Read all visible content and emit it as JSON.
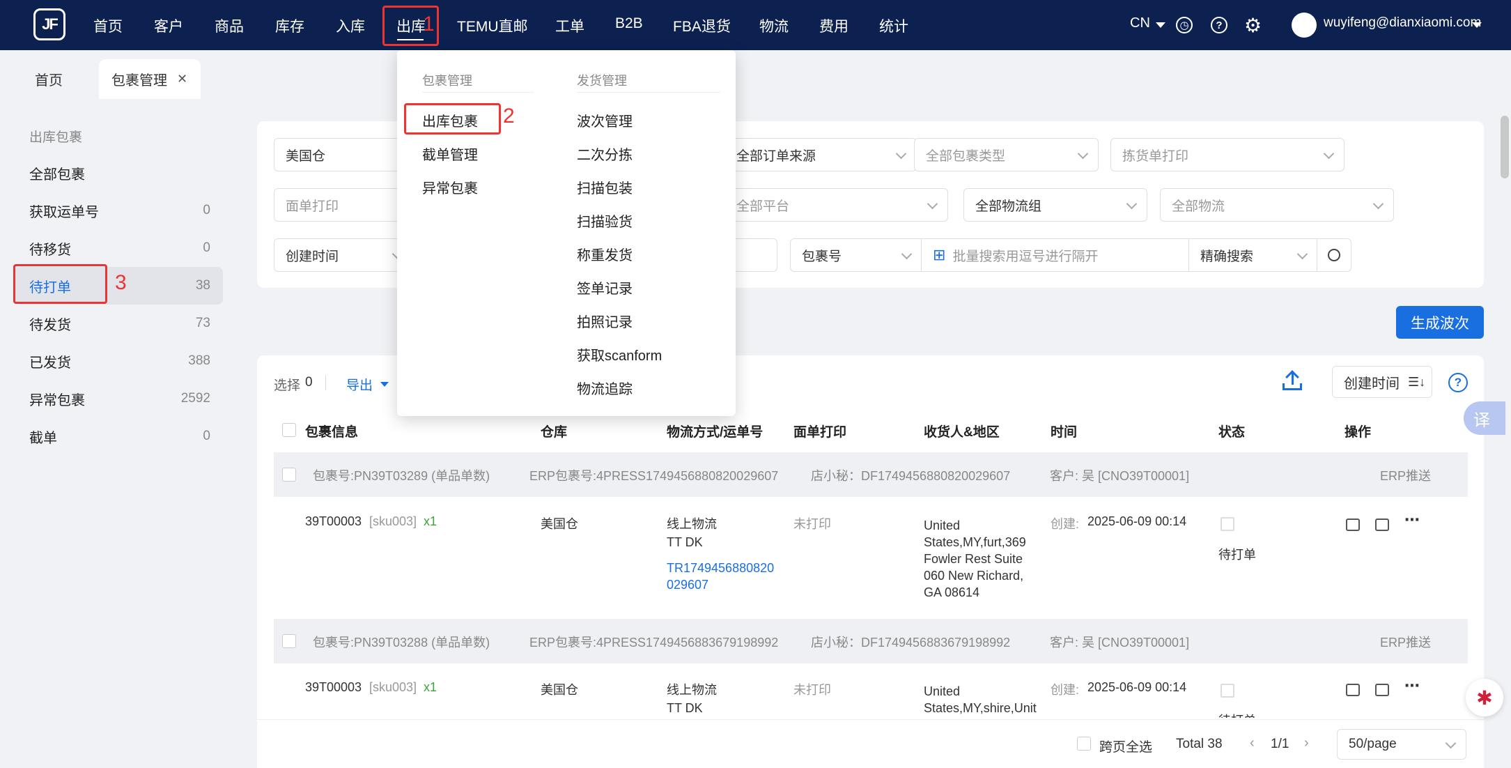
{
  "nav": {
    "logo": "JF",
    "items": [
      "首页",
      "客户",
      "商品",
      "库存",
      "入库",
      "出库",
      "TEMU直邮",
      "工单",
      "B2B",
      "FBA退货",
      "物流",
      "费用",
      "统计"
    ],
    "lang": "CN",
    "user": "wuyifeng@dianxiaomi.com"
  },
  "tabs": {
    "home": "首页",
    "current": "包裹管理",
    "close": "✕"
  },
  "sidebar": {
    "title": "出库包裹",
    "items": [
      {
        "label": "全部包裹",
        "count": ""
      },
      {
        "label": "获取运单号",
        "count": "0"
      },
      {
        "label": "待移货",
        "count": "0"
      },
      {
        "label": "待打单",
        "count": "38"
      },
      {
        "label": "待发货",
        "count": "73"
      },
      {
        "label": "已发货",
        "count": "388"
      },
      {
        "label": "异常包裹",
        "count": "2592"
      },
      {
        "label": "截单",
        "count": "0"
      }
    ]
  },
  "filters": {
    "warehouse": "美国仓",
    "order_source": "全部订单来源",
    "package_type": "全部包裹类型",
    "pick_print": "拣货单打印",
    "label_print": "面单打印",
    "platform": "全部平台",
    "logistics_group": "全部物流组",
    "logistics": "全部物流",
    "time_type": "创建时间",
    "search_type": "包裹号",
    "search_placeholder": "批量搜索用逗号进行隔开",
    "search_mode": "精确搜索"
  },
  "actions": {
    "generate_wave": "生成波次",
    "select_label": "选择",
    "select_count": "0",
    "export": "导出",
    "sort": "创建时间",
    "sort_icon": "☰↓",
    "help": "?",
    "translate": "译"
  },
  "table": {
    "headers": [
      "包裹信息",
      "仓库",
      "物流方式/运单号",
      "面单打印",
      "收货人&地区",
      "时间",
      "状态",
      "操作"
    ],
    "groups": [
      {
        "package_no": "包裹号:PN39T03289 (单品单数)",
        "erp_no": "ERP包裹号:4PRESS1749456880820029607",
        "shop_secret": "店小秘：DF1749456880820029607",
        "customer": "客户: 吴 [CNO39T00001]",
        "erp_push": "ERP推送",
        "item": "39T00003",
        "sku": "[sku003]",
        "qty": "x1",
        "warehouse": "美国仓",
        "logistics": "线上物流",
        "carrier": "TT DK",
        "tracking1": "TR1749456880820",
        "tracking2": "029607",
        "print": "未打印",
        "address": [
          "United",
          "States,MY,furt,369",
          "Fowler Rest Suite",
          "060 New Richard,",
          "GA 08614"
        ],
        "time_label": "创建:",
        "time": "2025-06-09 00:14",
        "status": "待打单"
      },
      {
        "package_no": "包裹号:PN39T03288 (单品单数)",
        "erp_no": "ERP包裹号:4PRESS1749456883679198992",
        "shop_secret": "店小秘：DF1749456883679198992",
        "customer": "客户: 吴 [CNO39T00001]",
        "erp_push": "ERP推送",
        "item": "39T00003",
        "sku": "[sku003]",
        "qty": "x1",
        "warehouse": "美国仓",
        "logistics": "线上物流",
        "carrier": "TT DK",
        "print": "未打印",
        "address": [
          "United",
          "States,MY,shire,Unit"
        ],
        "time_label": "创建:",
        "time": "2025-06-09 00:14",
        "status": "待打单"
      }
    ]
  },
  "footer": {
    "cross_select": "跨页全选",
    "total": "Total 38",
    "page": "1/1",
    "page_size": "50/page"
  },
  "dropdown": {
    "col1_title": "包裹管理",
    "col1": [
      "出库包裹",
      "截单管理",
      "异常包裹"
    ],
    "col2_title": "发货管理",
    "col2": [
      "波次管理",
      "二次分拣",
      "扫描包装",
      "扫描验货",
      "称重发货",
      "签单记录",
      "拍照记录",
      "获取scanform",
      "物流追踪"
    ]
  },
  "annotations": [
    "1",
    "2",
    "3"
  ]
}
